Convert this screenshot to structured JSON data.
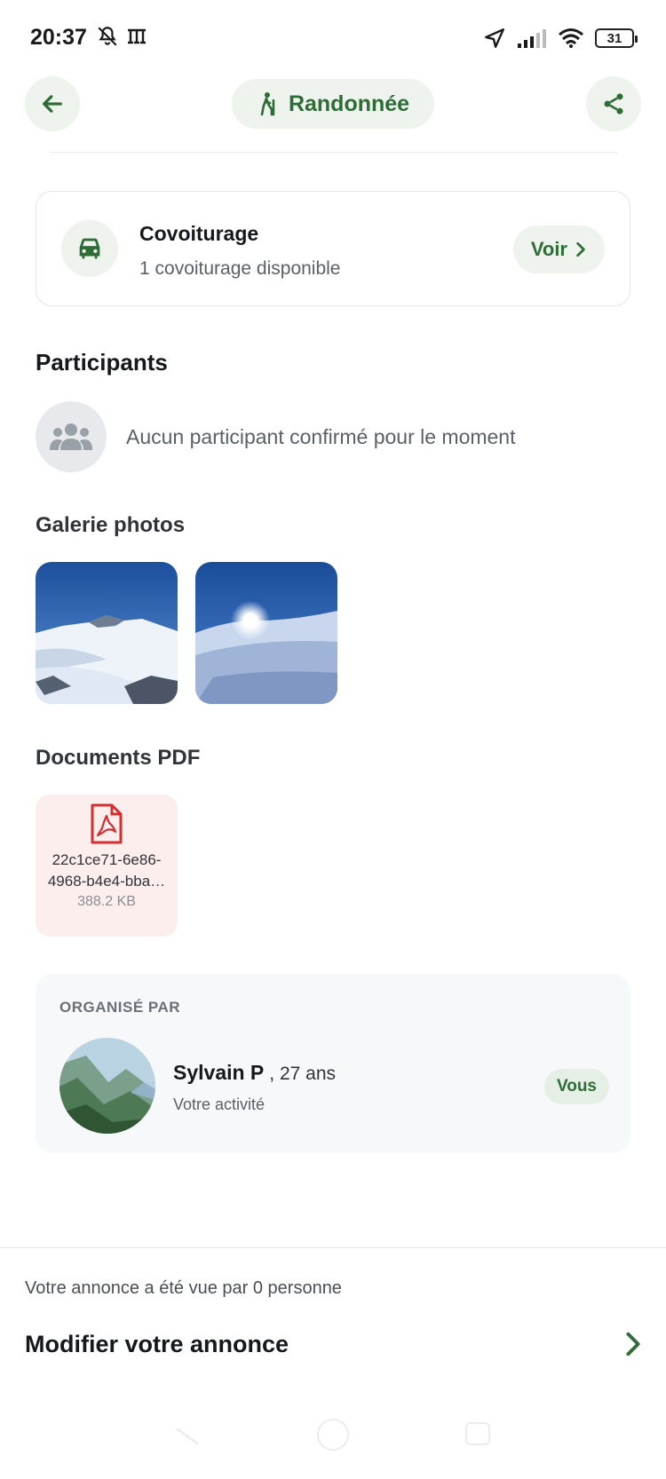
{
  "status_bar": {
    "time": "20:37",
    "battery": "31"
  },
  "header": {
    "category_label": "Randonnée"
  },
  "carpool": {
    "title": "Covoiturage",
    "subtitle": "1 covoiturage disponible",
    "action_label": "Voir"
  },
  "participants": {
    "title": "Participants",
    "empty_text": "Aucun participant confirmé pour le moment"
  },
  "gallery": {
    "title": "Galerie photos",
    "photo_count": 2
  },
  "documents": {
    "title": "Documents PDF",
    "items": [
      {
        "name_line1": "22c1ce71-6e86-",
        "name_line2": "4968-b4e4-bba…",
        "size": "388.2 KB"
      }
    ]
  },
  "organizer": {
    "label": "ORGANISÉ PAR",
    "name": "Sylvain P",
    "age": ", 27 ans",
    "subtitle": "Votre activité",
    "badge": "Vous"
  },
  "footer": {
    "views_text": "Votre annonce a été vue par 0 personne",
    "edit_label": "Modifier votre annonce"
  },
  "colors": {
    "accent_green": "#2f6d36",
    "pill_bg": "#eef3ee",
    "pdf_red": "#d32f2f",
    "pdf_bg": "#fdeeee"
  }
}
